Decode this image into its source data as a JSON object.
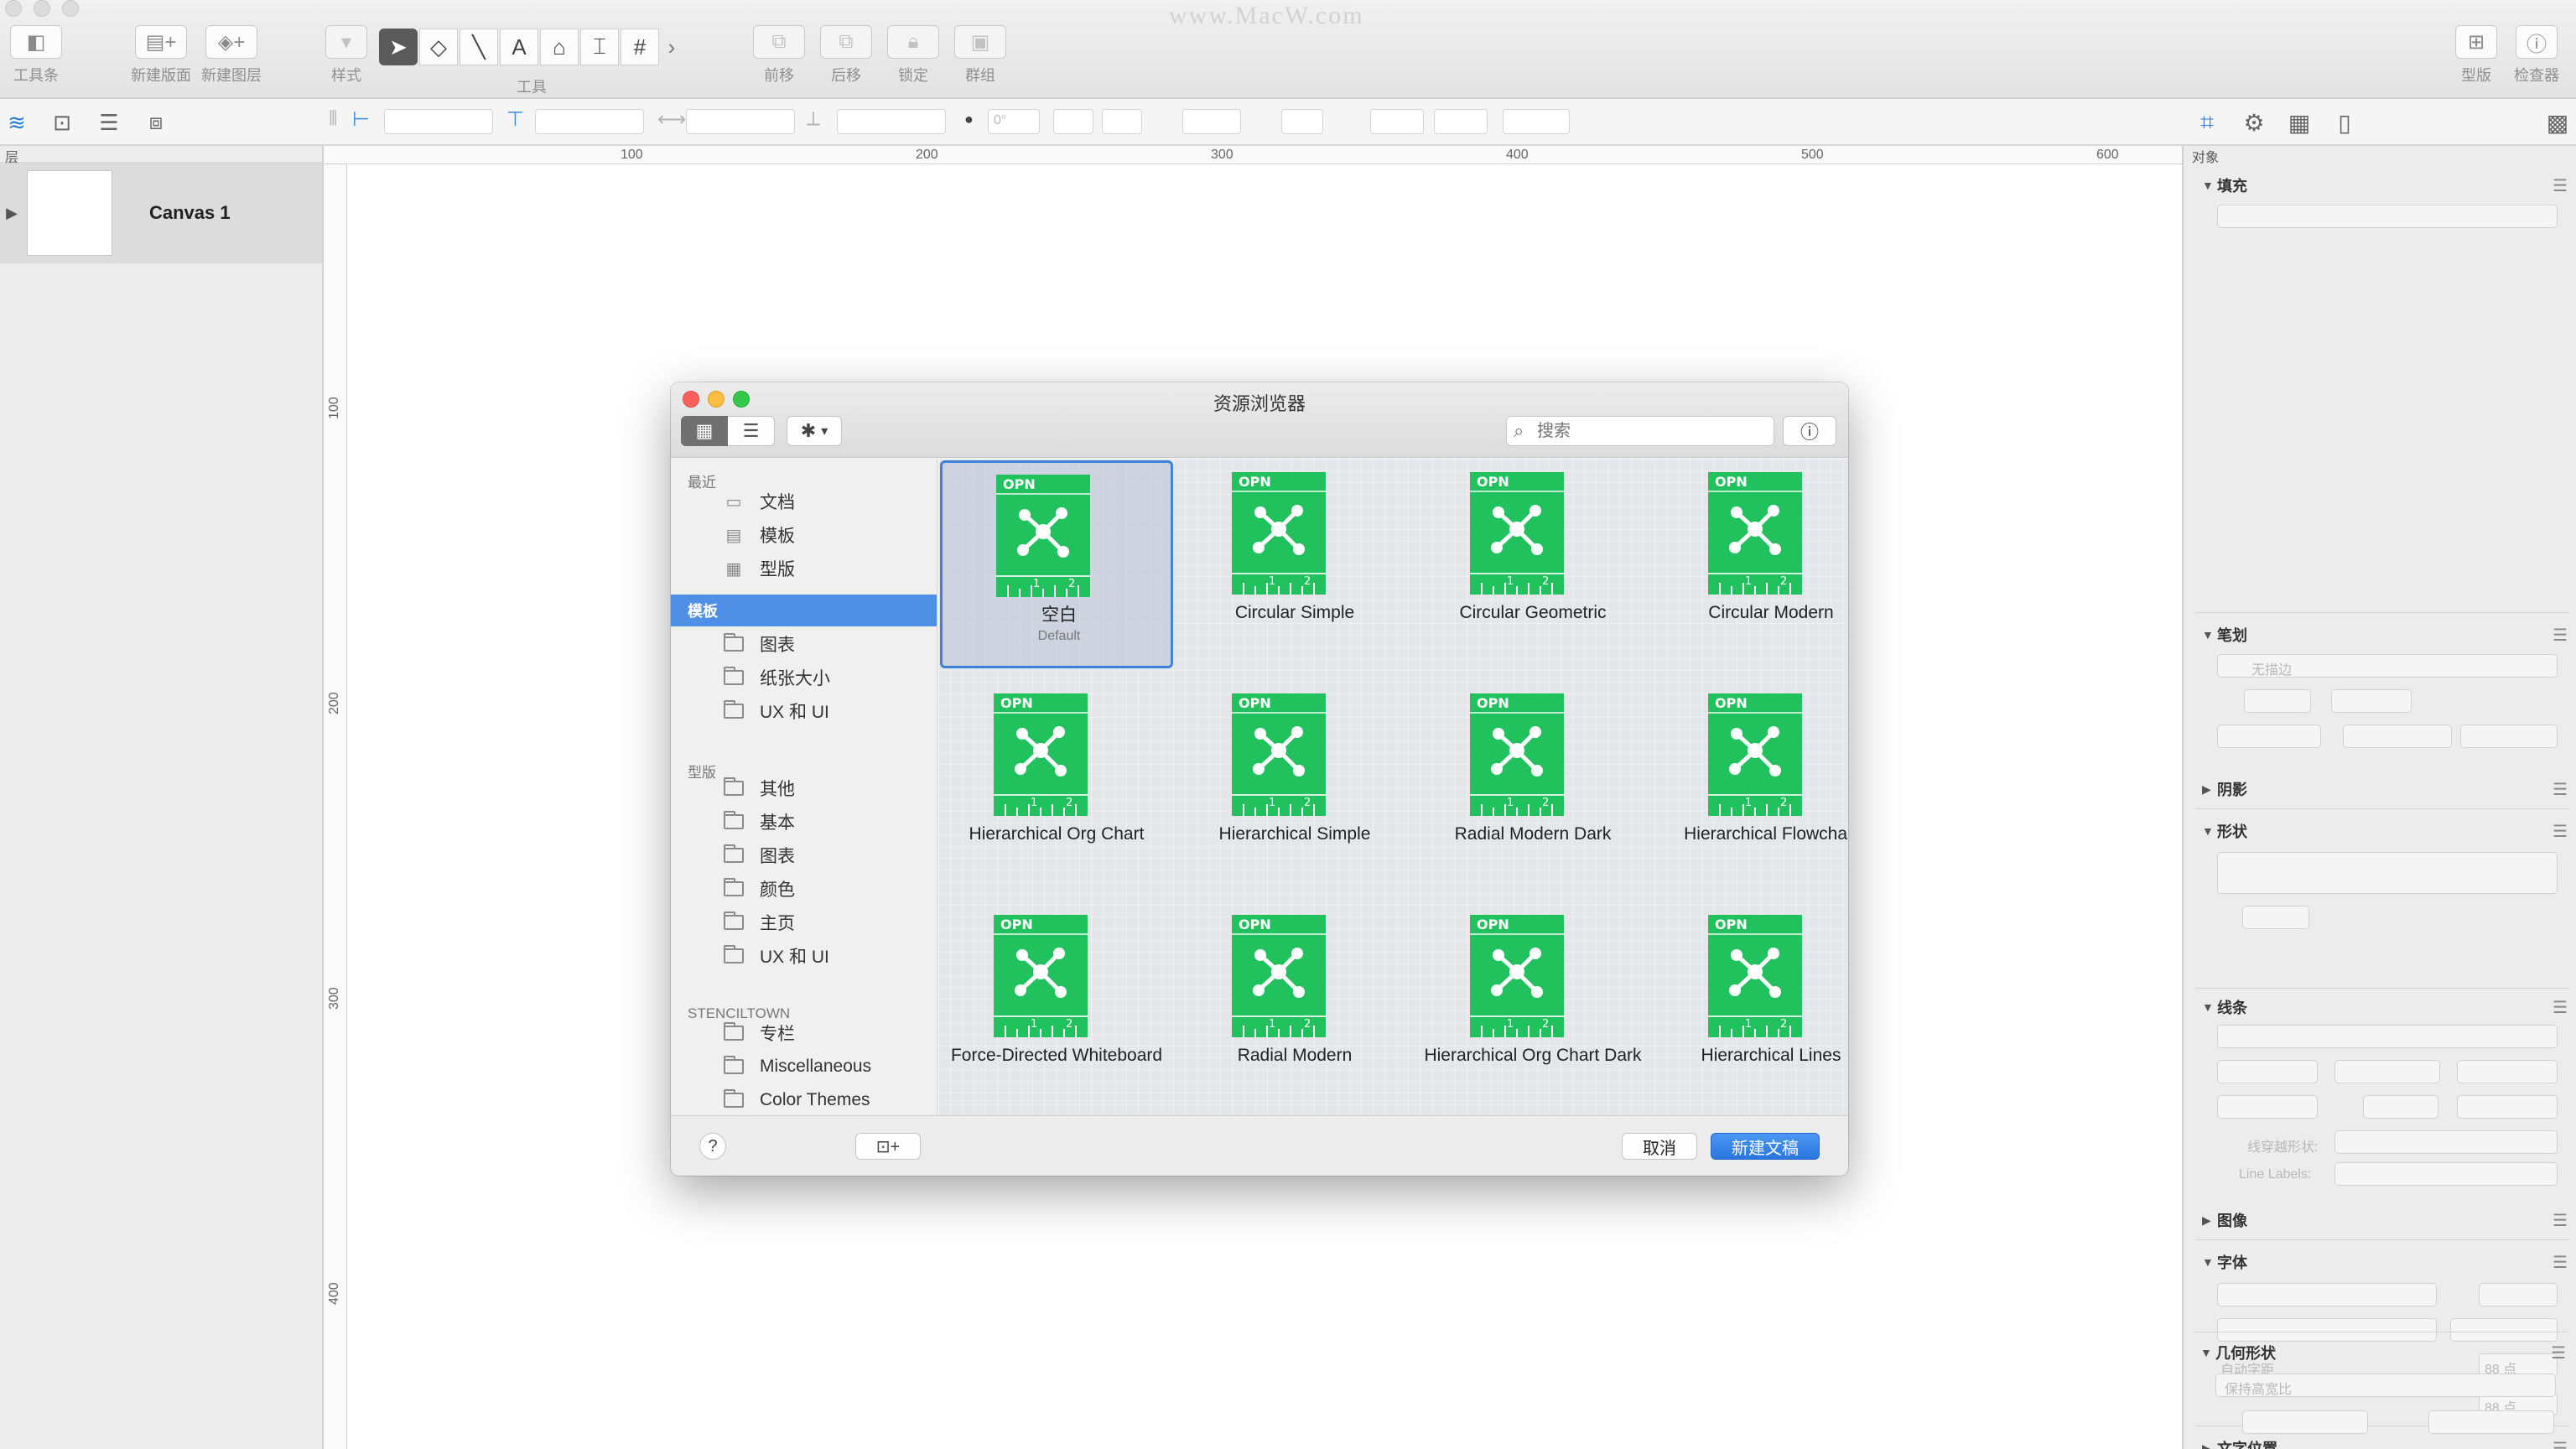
{
  "toolbar": {
    "watermark": "www.MacW.com",
    "left_buttons": [
      {
        "label": "工具条",
        "icon": "sidebar-icon"
      },
      {
        "label": "新建版面",
        "icon": "new-canvas-icon"
      },
      {
        "label": "新建图层",
        "icon": "new-layer-icon"
      }
    ],
    "style_label": "样式",
    "tools_label": "工具",
    "tools": [
      {
        "name": "select",
        "glyph": "➤",
        "icon": "pointer-icon"
      },
      {
        "name": "shape",
        "glyph": "◇",
        "icon": "shape-icon"
      },
      {
        "name": "line",
        "glyph": "╲",
        "icon": "line-icon"
      },
      {
        "name": "text",
        "glyph": "A",
        "icon": "text-icon"
      },
      {
        "name": "pen",
        "glyph": "⌂",
        "icon": "pen-icon"
      },
      {
        "name": "style-brush",
        "glyph": "⌶",
        "icon": "style-brush-icon"
      },
      {
        "name": "diagram",
        "glyph": "#",
        "icon": "diagram-icon"
      },
      {
        "name": "more",
        "glyph": "›",
        "icon": "more-tools-icon"
      }
    ],
    "arrange_buttons": [
      {
        "label": "前移",
        "icon": "bring-forward-icon"
      },
      {
        "label": "后移",
        "icon": "send-backward-icon"
      },
      {
        "label": "锁定",
        "icon": "lock-icon"
      },
      {
        "label": "群组",
        "icon": "group-icon"
      }
    ],
    "right_buttons": [
      {
        "label": "型版",
        "icon": "stencil-icon"
      },
      {
        "label": "检查器",
        "icon": "inspector-icon"
      }
    ]
  },
  "toolbar2": {
    "rotation_value": "0°"
  },
  "sidebar": {
    "header": "层",
    "canvas_name": "Canvas 1"
  },
  "ruler": {
    "top_labels": [
      "100",
      "200",
      "300",
      "400",
      "500",
      "600"
    ],
    "left_labels": [
      "100",
      "200",
      "300",
      "400"
    ]
  },
  "inspector": {
    "header": "对象",
    "sections": {
      "fill": "填充",
      "stroke": "笔划",
      "stroke_none": "无描边",
      "shadow": "阴影",
      "shape": "形状",
      "lines": "线条",
      "line_cross": "线穿越形状:",
      "line_labels": "Line Labels:",
      "image": "图像",
      "font": "字体",
      "auto_kern": "自动字距",
      "spacing_a": "88 点",
      "spacing_b": "88 点",
      "text_position": "文字位置",
      "geometry": "几何形状",
      "keep_ratio": "保持高宽比"
    }
  },
  "dialog": {
    "title": "资源浏览器",
    "search_placeholder": "搜索",
    "view_grid_icon": "grid-view-icon",
    "view_list_icon": "list-view-icon",
    "sidebar": {
      "recent_header": "最近",
      "recent_items": [
        "文档",
        "模板",
        "型版"
      ],
      "templates_header": "模板",
      "template_items": [
        "图表",
        "纸张大小",
        "UX 和 UI"
      ],
      "stencils_header": "型版",
      "stencil_items": [
        "其他",
        "基本",
        "图表",
        "颜色",
        "主页",
        "UX 和 UI"
      ],
      "stenciltown_header": "STENCILTOWN",
      "stenciltown_items": [
        "专栏",
        "Miscellaneous",
        "Color Themes"
      ]
    },
    "templates": [
      {
        "name": "空白",
        "sub": "Default",
        "selected": true
      },
      {
        "name": "Circular Simple"
      },
      {
        "name": "Circular Geometric"
      },
      {
        "name": "Circular Modern"
      },
      {
        "name": "Hierarchical Org Chart"
      },
      {
        "name": "Hierarchical Simple"
      },
      {
        "name": "Radial Modern Dark"
      },
      {
        "name": "Hierarchical Flowchart"
      },
      {
        "name": "Force-Directed Whiteboard"
      },
      {
        "name": "Radial Modern"
      },
      {
        "name": "Hierarchical Org Chart Dark"
      },
      {
        "name": "Hierarchical Lines"
      }
    ],
    "template_icon_text": {
      "top": "OPN",
      "a": "1",
      "b": "2"
    },
    "footer": {
      "help": "?",
      "cancel": "取消",
      "create": "新建文稿"
    }
  },
  "colors": {
    "accent": "#2b7bd6",
    "selection": "#4f8fe6",
    "template_green": "#21c25e",
    "close": "#fc605c",
    "minimize": "#fdbc40",
    "zoom": "#34c84a"
  }
}
